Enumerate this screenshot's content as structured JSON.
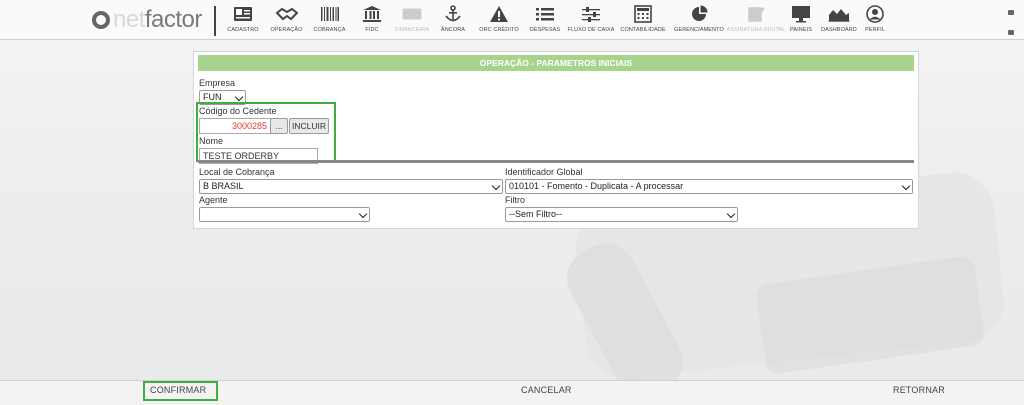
{
  "brand": {
    "logo_net": "net",
    "logo_factor": "factor"
  },
  "nav": [
    {
      "label": "CADASTRO",
      "icon": "id-card-icon"
    },
    {
      "label": "OPERAÇÃO",
      "icon": "handshake-icon"
    },
    {
      "label": "COBRANÇA",
      "icon": "barcode-icon"
    },
    {
      "label": "FIDC",
      "icon": "bank-icon"
    },
    {
      "label": "FINANCEIRA",
      "icon": "money-icon",
      "disabled": true
    },
    {
      "label": "ÂNCORA",
      "icon": "anchor-icon"
    },
    {
      "label": "ORC CRÉDITO",
      "icon": "warning-icon"
    },
    {
      "label": "DESPESAS",
      "icon": "list-icon"
    },
    {
      "label": "FLUXO DE CAIXA",
      "icon": "sliders-icon"
    },
    {
      "label": "CONTABILIDADE",
      "icon": "calculator-icon"
    },
    {
      "label": "GERENCIAMENTO",
      "icon": "pie-chart-icon"
    },
    {
      "label": "ASSINATURA DIGITAL",
      "icon": "edit-icon",
      "disabled": true
    },
    {
      "label": "PAINEIS",
      "icon": "monitor-icon"
    },
    {
      "label": "DASHBOARD",
      "icon": "area-chart-icon"
    },
    {
      "label": "PERFIL",
      "icon": "user-icon"
    }
  ],
  "form": {
    "title": "OPERAÇÃO - PARAMETROS INICIAIS",
    "empresa_label": "Empresa",
    "empresa_value": "FUN",
    "cedente_label": "Código do Cedente",
    "cedente_value": "3000285",
    "cedente_lookup": "...",
    "incluir_label": "INCLUIR",
    "nome_label": "Nome",
    "nome_value": "TESTE ORDERBY",
    "local_cobranca_label": "Local de Cobrança",
    "local_cobranca_value": "B BRASIL",
    "identificador_label": "Identificador Global",
    "identificador_value": "010101 - Fomento - Duplicata - A processar",
    "agente_label": "Agente",
    "agente_value": "",
    "filtro_label": "Filtro",
    "filtro_value": "--Sem Filtro--"
  },
  "footer": {
    "confirm": "CONFIRMAR",
    "cancel": "CANCELAR",
    "back": "RETORNAR"
  },
  "colors": {
    "header_green": "#a6d48d",
    "highlight_green": "#3fae3f",
    "cedente_red": "#e53935"
  }
}
